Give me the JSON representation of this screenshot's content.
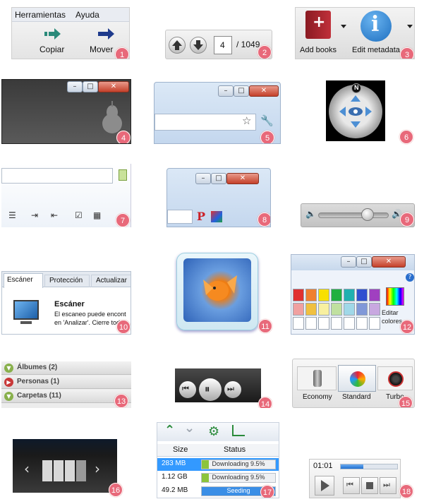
{
  "t1": {
    "menu": [
      "Herramientas",
      "Ayuda"
    ],
    "copy_label": "Copiar",
    "move_label": "Mover",
    "badge": "1"
  },
  "t2": {
    "page": "4",
    "total": "/ 1049",
    "badge": "2"
  },
  "t3": {
    "add_label": "Add books",
    "edit_label": "Edit metadata",
    "badge": "3"
  },
  "t4": {
    "badge": "4"
  },
  "t5": {
    "badge": "5"
  },
  "t6": {
    "north": "N",
    "badge": "6"
  },
  "t7": {
    "badge": "7"
  },
  "t8": {
    "badge": "8"
  },
  "t9": {
    "badge": "9",
    "level": 0.7
  },
  "t10": {
    "tabs": [
      "Escáner",
      "Protección",
      "Actualizar"
    ],
    "heading": "Escáner",
    "line1": "El escaneo puede encont",
    "line2": "en 'Analizar'. Cierre todo",
    "badge": "10"
  },
  "t11": {
    "badge": "11"
  },
  "t12": {
    "edit_colors": "Editar colores",
    "badge": "12",
    "help": "?"
  },
  "t13": {
    "rows": [
      "Álbumes (2)",
      "Personas (1)",
      "Carpetas (11)"
    ],
    "badge": "13"
  },
  "t14": {
    "badge": "14"
  },
  "t15": {
    "modes": [
      "Economy",
      "Standard",
      "Turbo"
    ],
    "badge": "15"
  },
  "t16": {
    "badge": "16"
  },
  "t17": {
    "headers": [
      "Size",
      "Status"
    ],
    "rows": [
      {
        "size": "283 MB",
        "status": "Downloading 9.5%",
        "progress": 0.095
      },
      {
        "size": "1.12 GB",
        "status": "Downloading 9.5%",
        "progress": 0.095
      },
      {
        "size": "49.2 MB",
        "status": "Seeding",
        "progress": 1.0
      }
    ],
    "badge": "17"
  },
  "t18": {
    "time": "01:01",
    "badge": "18",
    "progress": 0.4
  },
  "colors": {
    "badge": "#e8697a",
    "win_close": "#c4402a",
    "seed_blue": "#3a8ee6",
    "dl_green": "#8cc43c",
    "selected_row": "#3399ff"
  }
}
